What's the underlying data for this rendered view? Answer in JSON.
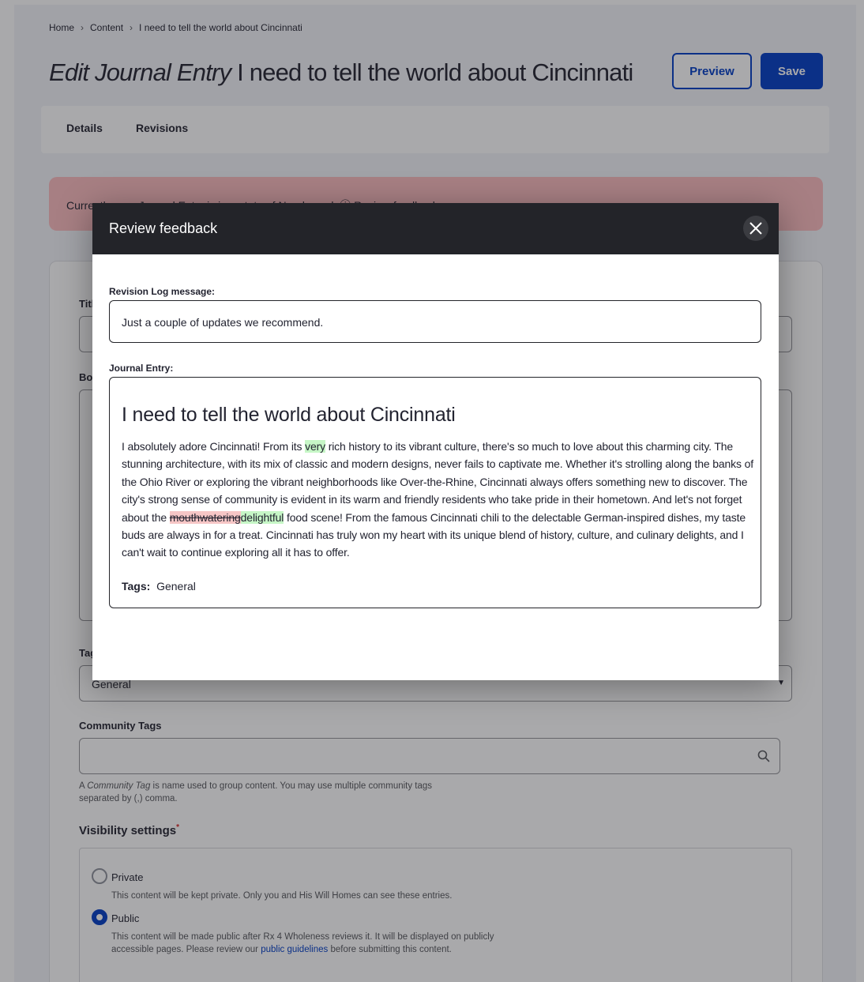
{
  "breadcrumb": [
    "Home",
    "Content",
    "I need to tell the world about Cincinnati"
  ],
  "page": {
    "title_prefix": "Edit Journal Entry",
    "title_rest": " I need to tell the world about Cincinnati",
    "preview_label": "Preview",
    "save_label": "Save"
  },
  "tabs": [
    "Details",
    "Revisions"
  ],
  "alert": {
    "text": "Currently your Journal Entry is in a state of Needs work ⓘ Review feedback"
  },
  "form": {
    "title_label": "Title",
    "body_label": "Body",
    "tags_label": "Tags",
    "tags_value": "General",
    "community_tags_label": "Community Tags",
    "community_tags_desc_pre": "A ",
    "community_tags_desc_em": "Community Tag",
    "community_tags_desc_post": " is name used to group content. You may use multiple community tags separated by (,) comma.",
    "visibility_label": "Visibility settings",
    "required_mark": "*",
    "private_label": "Private",
    "private_desc": "This content will be kept private. Only you and His Will Homes can see these entries.",
    "public_label": "Public",
    "public_desc_pre": "This content will be made public after Rx 4 Wholeness reviews it. It will be displayed on publicly accessible pages. Please review our ",
    "public_desc_link": "public guidelines",
    "public_desc_post": " before submitting this content."
  },
  "modal": {
    "title": "Review feedback",
    "log_label": "Revision Log message:",
    "log_value": "Just a couple of updates we recommend.",
    "entry_label": "Journal Entry:",
    "entry_title": "I need to tell the world about Cincinnati",
    "body": {
      "p1": "I absolutely adore Cincinnati! From its ",
      "ins1": "very",
      "p2": " rich history to its vibrant culture, there's so much to love about this charming city. The stunning architecture, with its mix of classic and modern designs, never fails to captivate me. Whether it's strolling along the banks of the Ohio River or exploring the vibrant neighborhoods like Over-the-Rhine, Cincinnati always offers something new to discover. The city's strong sense of community is evident in its warm and friendly residents who take pride in their hometown. And let's not forget about the ",
      "del1": "mouthwatering",
      "ins2": "delightful",
      "p3": " food scene! From the famous Cincinnati chili to the delectable German-inspired dishes, my taste buds are always in for a treat. Cincinnati has truly won my heart with its unique blend of history, culture, and culinary delights, and I can't wait to continue exploring all it has to offer."
    },
    "tags_label": "Tags:",
    "tags_value": "General"
  },
  "colors": {
    "accent": "#003cc5",
    "alert_bg": "#fcbcbf",
    "insert_bg": "#c6f6c6",
    "delete_bg": "#f6c6c6",
    "modal_header": "#232429"
  },
  "icons": {
    "close": "close-icon",
    "search": "search-icon",
    "chevron": "chevron-right-icon"
  }
}
